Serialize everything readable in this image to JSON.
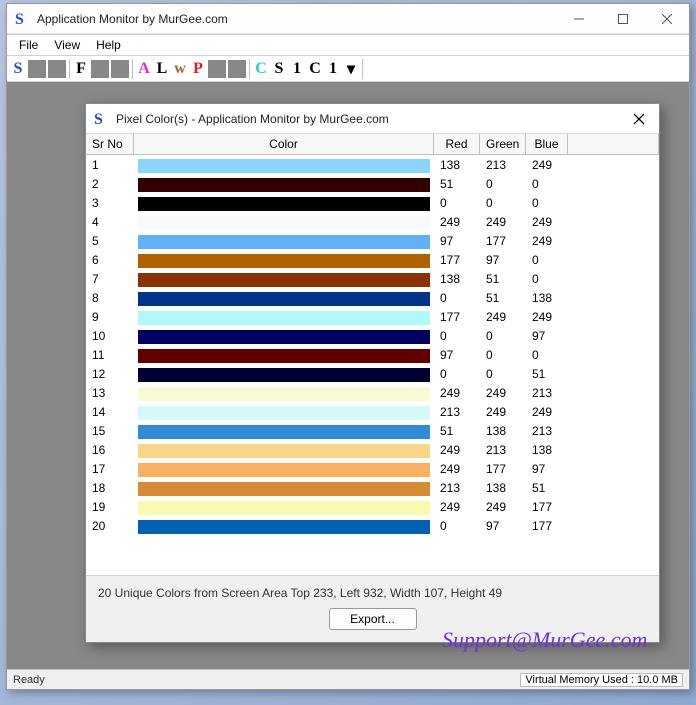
{
  "main": {
    "title": "Application Monitor by MurGee.com",
    "menus": [
      "File",
      "View",
      "Help"
    ],
    "status_ready": "Ready",
    "status_mem": "Virtual Memory Used : 10.0 MB",
    "support": "Support@MurGee.com"
  },
  "toolbar": {
    "items": [
      {
        "t": "glyph",
        "label": "S",
        "color": "#2050c0",
        "name": "tool-s"
      },
      {
        "t": "box",
        "name": "tool-box-1"
      },
      {
        "t": "box",
        "name": "tool-box-2"
      },
      {
        "t": "sep"
      },
      {
        "t": "glyph",
        "label": "F",
        "color": "#000",
        "name": "tool-f"
      },
      {
        "t": "box",
        "name": "tool-box-3"
      },
      {
        "t": "box",
        "name": "tool-box-4"
      },
      {
        "t": "sep"
      },
      {
        "t": "glyph",
        "label": "A",
        "color": "#e030d0",
        "name": "tool-a"
      },
      {
        "t": "glyph",
        "label": "L",
        "color": "#000",
        "name": "tool-l"
      },
      {
        "t": "glyph",
        "label": "w",
        "color": "#a06830",
        "name": "tool-w"
      },
      {
        "t": "glyph",
        "label": "P",
        "color": "#e02020",
        "name": "tool-p"
      },
      {
        "t": "box",
        "name": "tool-box-5"
      },
      {
        "t": "box",
        "name": "tool-box-6"
      },
      {
        "t": "sep"
      },
      {
        "t": "glyph",
        "label": "C",
        "color": "#20d0d0",
        "name": "tool-c1"
      },
      {
        "t": "glyph",
        "label": "S",
        "color": "#000",
        "name": "tool-s2"
      },
      {
        "t": "glyph",
        "label": "1",
        "color": "#000",
        "name": "tool-1"
      },
      {
        "t": "glyph",
        "label": "C",
        "color": "#000",
        "name": "tool-c2"
      },
      {
        "t": "glyph",
        "label": "1",
        "color": "#000",
        "name": "tool-1b"
      },
      {
        "t": "glyph",
        "label": "▾",
        "color": "#000",
        "name": "tool-dropdown"
      },
      {
        "t": "sep"
      }
    ]
  },
  "dialog": {
    "title": "Pixel Color(s) - Application Monitor by MurGee.com",
    "columns": [
      "Sr No",
      "Color",
      "Red",
      "Green",
      "Blue"
    ],
    "description": "20 Unique Colors from Screen Area Top 233, Left 932, Width 107, Height 49",
    "export_label": "Export...",
    "rows": [
      {
        "n": 1,
        "r": 138,
        "g": 213,
        "b": 249
      },
      {
        "n": 2,
        "r": 51,
        "g": 0,
        "b": 0
      },
      {
        "n": 3,
        "r": 0,
        "g": 0,
        "b": 0
      },
      {
        "n": 4,
        "r": 249,
        "g": 249,
        "b": 249
      },
      {
        "n": 5,
        "r": 97,
        "g": 177,
        "b": 249
      },
      {
        "n": 6,
        "r": 177,
        "g": 97,
        "b": 0
      },
      {
        "n": 7,
        "r": 138,
        "g": 51,
        "b": 0
      },
      {
        "n": 8,
        "r": 0,
        "g": 51,
        "b": 138
      },
      {
        "n": 9,
        "r": 177,
        "g": 249,
        "b": 249
      },
      {
        "n": 10,
        "r": 0,
        "g": 0,
        "b": 97
      },
      {
        "n": 11,
        "r": 97,
        "g": 0,
        "b": 0
      },
      {
        "n": 12,
        "r": 0,
        "g": 0,
        "b": 51
      },
      {
        "n": 13,
        "r": 249,
        "g": 249,
        "b": 213
      },
      {
        "n": 14,
        "r": 213,
        "g": 249,
        "b": 249
      },
      {
        "n": 15,
        "r": 51,
        "g": 138,
        "b": 213
      },
      {
        "n": 16,
        "r": 249,
        "g": 213,
        "b": 138
      },
      {
        "n": 17,
        "r": 249,
        "g": 177,
        "b": 97
      },
      {
        "n": 18,
        "r": 213,
        "g": 138,
        "b": 51
      },
      {
        "n": 19,
        "r": 249,
        "g": 249,
        "b": 177
      },
      {
        "n": 20,
        "r": 0,
        "g": 97,
        "b": 177
      }
    ]
  }
}
